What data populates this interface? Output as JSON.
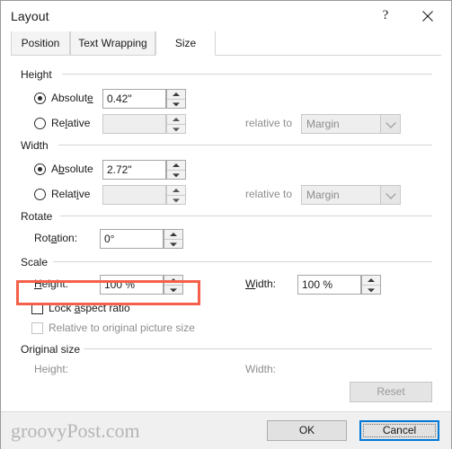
{
  "window": {
    "title": "Layout",
    "help_icon": "question-mark-icon",
    "close_icon": "close-icon"
  },
  "tabs": [
    {
      "label": "Position",
      "active": false
    },
    {
      "label": "Text Wrapping",
      "active": false
    },
    {
      "label": "Size",
      "active": true
    }
  ],
  "height_group": {
    "title": "Height",
    "absolute_label": "Absolute",
    "absolute_value": "0.42\"",
    "absolute_selected": true,
    "relative_label": "Relative",
    "relative_value": "",
    "relative_selected": false,
    "relative_to_label": "relative to",
    "relative_to_value": "Margin"
  },
  "width_group": {
    "title": "Width",
    "absolute_label": "Absolute",
    "absolute_value": "2.72\"",
    "absolute_selected": true,
    "relative_label": "Relative",
    "relative_value": "",
    "relative_selected": false,
    "relative_to_label": "relative to",
    "relative_to_value": "Margin"
  },
  "rotate_group": {
    "title": "Rotate",
    "rotation_label": "Rotation:",
    "rotation_value": "0°",
    "highlight_color": "#f4604a"
  },
  "scale_group": {
    "title": "Scale",
    "height_label": "Height:",
    "height_value": "100 %",
    "width_label": "Width:",
    "width_value": "100 %",
    "lock_aspect_label": "Lock aspect ratio",
    "lock_aspect_checked": false,
    "relative_original_label": "Relative to original picture size",
    "relative_original_checked": false
  },
  "original_size_group": {
    "title": "Original size",
    "height_label": "Height:",
    "height_value": "",
    "width_label": "Width:",
    "width_value": "",
    "reset_label": "Reset"
  },
  "footer": {
    "watermark": "groovyPost.com",
    "ok_label": "OK",
    "cancel_label": "Cancel",
    "accent_color": "#0078d7"
  }
}
